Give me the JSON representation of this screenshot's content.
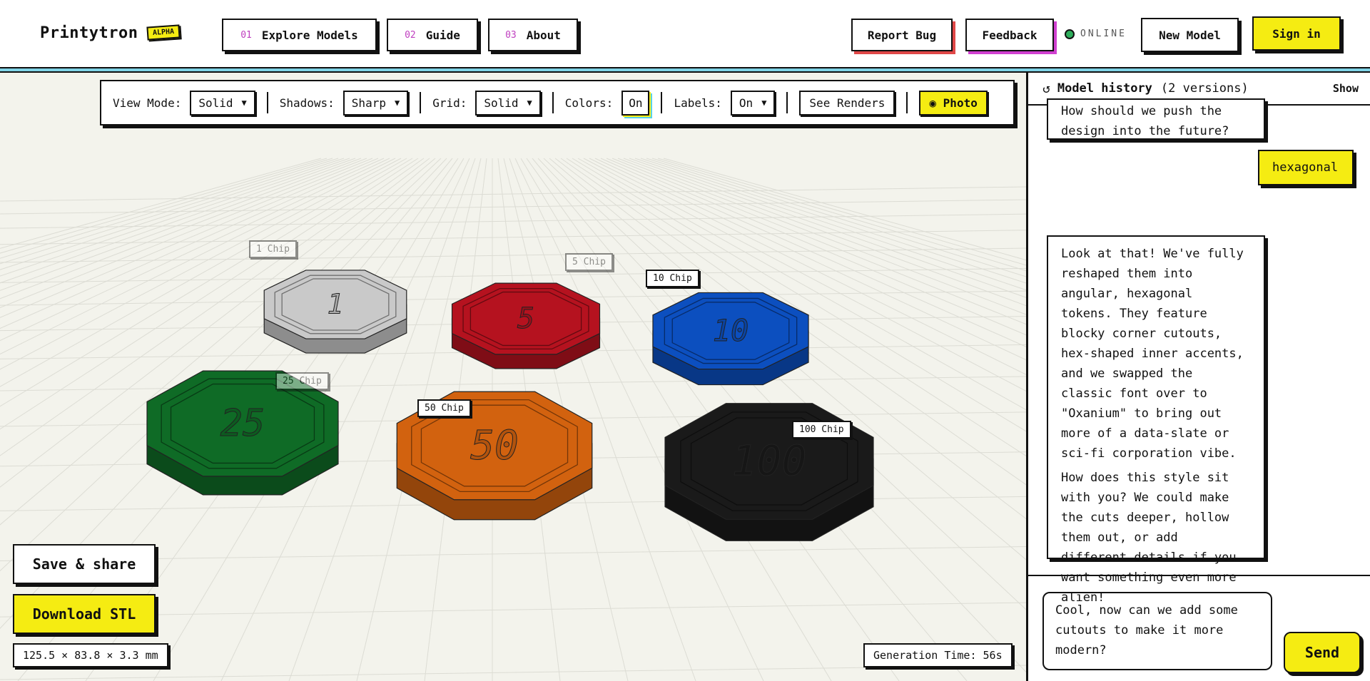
{
  "header": {
    "brand": "Printytron",
    "badge": "ALPHA",
    "nav": [
      {
        "num": "01",
        "label": "Explore Models"
      },
      {
        "num": "02",
        "label": "Guide"
      },
      {
        "num": "03",
        "label": "About"
      }
    ],
    "report_bug": "Report Bug",
    "feedback": "Feedback",
    "status": "ONLINE",
    "new_model": "New Model",
    "sign_in": "Sign in"
  },
  "toolbar": {
    "view_mode_label": "View Mode:",
    "view_mode_value": "Solid",
    "shadows_label": "Shadows:",
    "shadows_value": "Sharp",
    "grid_label": "Grid:",
    "grid_value": "Solid",
    "colors_label": "Colors:",
    "colors_value": "On",
    "labels_label": "Labels:",
    "labels_value": "On",
    "see_renders": "See Renders",
    "photo": "Photo"
  },
  "chips": [
    {
      "label": "1 Chip",
      "text": "1",
      "color": "#c9c9c9"
    },
    {
      "label": "5 Chip",
      "text": "5",
      "color": "#b5121f"
    },
    {
      "label": "10 Chip",
      "text": "10",
      "color": "#0c4fbf"
    },
    {
      "label": "25 Chip",
      "text": "25",
      "color": "#0f6b26"
    },
    {
      "label": "50 Chip",
      "text": "50",
      "color": "#d2620f"
    },
    {
      "label": "100 Chip",
      "text": "100",
      "color": "#1a1a1a"
    }
  ],
  "viewport": {
    "save_share": "Save & share",
    "download_stl": "Download STL",
    "dimensions": "125.5 × 83.8 × 3.3 mm",
    "generation_time": "Generation Time: 56s"
  },
  "sidebar": {
    "title": "Model history",
    "count": "(2 versions)",
    "show": "Show",
    "messages": [
      {
        "role": "assistant",
        "text": "How should we push the design into the future?"
      },
      {
        "role": "user",
        "text": "hexagonal"
      },
      {
        "role": "assistant",
        "text": "Look at that! We've fully reshaped them into angular, hexagonal tokens. They feature blocky corner cutouts, hex-shaped inner accents, and we swapped the classic font over to \"Oxanium\" to bring out more of a data-slate or sci-fi corporation vibe."
      },
      {
        "role": "assistant",
        "text": "How does this style sit with you? We could make the cuts deeper, hollow them out, or add different details if you want something even more alien!"
      }
    ],
    "compose_value": "Cool, now can we add some cutouts to make it more modern?",
    "send": "Send"
  },
  "colors": {
    "accent_yellow": "#f5ec12",
    "rule_cyan": "#7fd3e6",
    "online_green": "#2fae5c",
    "nav_number_magenta": "#c040c0"
  }
}
